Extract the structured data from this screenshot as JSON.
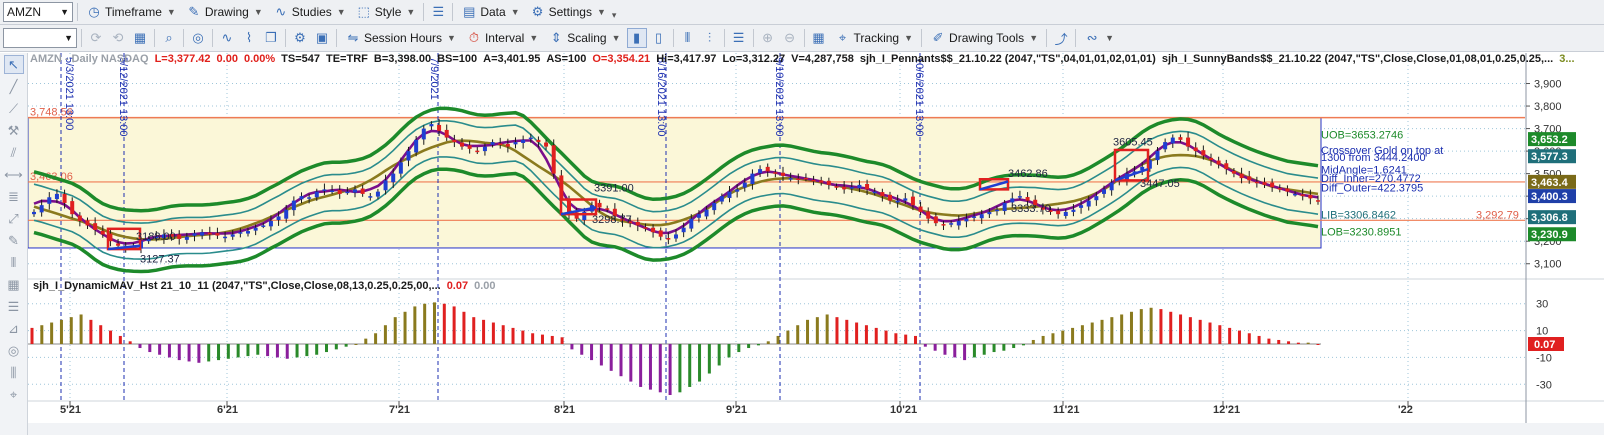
{
  "toolbar1": {
    "symbol": "AMZN",
    "items": [
      {
        "label": "Timeframe",
        "icon": "clock-icon"
      },
      {
        "label": "Drawing",
        "icon": "pencil-icon"
      },
      {
        "label": "Studies",
        "icon": "studies-icon"
      },
      {
        "label": "Style",
        "icon": "style-icon"
      },
      {
        "label": "Data",
        "icon": "data-icon"
      },
      {
        "label": "Settings",
        "icon": "gear-icon"
      }
    ]
  },
  "toolbar2": {
    "items": [
      {
        "label": "Session Hours",
        "icon": "session-hours-icon"
      },
      {
        "label": "Interval",
        "icon": "interval-icon"
      },
      {
        "label": "Scaling",
        "icon": "scaling-icon"
      },
      {
        "label": "Tracking",
        "icon": "tracking-icon"
      },
      {
        "label": "Drawing Tools",
        "icon": "drawing-tools-icon"
      }
    ]
  },
  "header": {
    "symbol_desc": "AMZN - Daily NASDAQ",
    "last": "L=3,377.42",
    "chg": "0.00",
    "pct": "0.00%",
    "ts": "TS=547",
    "te": "TE=TRF",
    "bid": "B=3,398.00",
    "bs": "BS=100",
    "ask": "A=3,401.95",
    "as": "AS=100",
    "open": "O=3,354.21",
    "hi": "Hi=3,417.97",
    "lo": "Lo=3,312.27",
    "vol": "V=4,287,758",
    "study1": "sjh_I_Pennants$$_21.10.22 (2047,\"TS\",04,01,01,02,01,01)",
    "study2": "sjh_I_SunnyBands$$_21.10.22 (2047,\"TS\",Close,Close,01,08,01,0.25,0.25,...",
    "study2_tail": "3..."
  },
  "indicator": {
    "name": "sjh_I_DynamicMAV_Hst 21_10_11 (2047,\"TS\",Close,Close,08,13,0.25,0.25,00,...",
    "value": "0.07",
    "value2": "0.00"
  },
  "chart_data": {
    "type": "candlestick",
    "symbol": "AMZN",
    "interval": "Daily",
    "y_ticks": [
      "3,900",
      "3,800",
      "3,700",
      "3,600",
      "3,500",
      "3,400",
      "3,300",
      "3,200",
      "3,100"
    ],
    "ylim": [
      3050,
      3960
    ],
    "x_ticks": [
      "5'21",
      "6'21",
      "7'21",
      "8'21",
      "9'21",
      "10'21",
      "11'21",
      "12'21",
      "'22"
    ],
    "closes": [
      3330,
      3360,
      3395,
      3410,
      3370,
      3320,
      3290,
      3270,
      3250,
      3230,
      3200,
      3180,
      3170,
      3175,
      3200,
      3210,
      3220,
      3230,
      3220,
      3210,
      3220,
      3235,
      3240,
      3230,
      3225,
      3220,
      3230,
      3240,
      3245,
      3260,
      3270,
      3290,
      3310,
      3340,
      3380,
      3400,
      3395,
      3420,
      3430,
      3425,
      3410,
      3420,
      3430,
      3410,
      3400,
      3420,
      3470,
      3500,
      3550,
      3600,
      3650,
      3700,
      3720,
      3690,
      3660,
      3640,
      3620,
      3610,
      3600,
      3620,
      3640,
      3630,
      3620,
      3640,
      3650,
      3660,
      3640,
      3620,
      3500,
      3380,
      3320,
      3300,
      3330,
      3360,
      3350,
      3340,
      3310,
      3290,
      3280,
      3270,
      3260,
      3240,
      3220,
      3210,
      3230,
      3260,
      3300,
      3320,
      3340,
      3370,
      3400,
      3420,
      3430,
      3460,
      3500,
      3520,
      3510,
      3500,
      3490,
      3480,
      3475,
      3480,
      3470,
      3460,
      3450,
      3440,
      3430,
      3440,
      3450,
      3430,
      3420,
      3400,
      3380,
      3380,
      3390,
      3360,
      3330,
      3300,
      3280,
      3270,
      3280,
      3290,
      3300,
      3310,
      3320,
      3330,
      3340,
      3370,
      3390,
      3400,
      3380,
      3360,
      3340,
      3330,
      3320,
      3330,
      3340,
      3360,
      3380,
      3400,
      3430,
      3460,
      3480,
      3500,
      3510,
      3530,
      3560,
      3600,
      3640,
      3660,
      3650,
      3620,
      3600,
      3580,
      3560,
      3540,
      3520,
      3500,
      3480,
      3470,
      3460,
      3450,
      3440,
      3430,
      3420,
      3410,
      3400,
      3390,
      3380
    ],
    "channel_top_label": "3,748.56",
    "channel_mid_label": "3,463.06",
    "right_line_label": "3,292.79",
    "annotations": [
      "3127.37",
      "3188.00",
      "3391.00",
      "3298.77",
      "3462.86",
      "3333.70",
      "3605.45",
      "3447.05"
    ],
    "vline_labels": [
      "5/3/2021 13:00",
      "5/12/2021 13:00",
      "7/9/2021",
      "8/16/2021 13:00",
      "9/10/2021 13:00",
      "10/6/2021 13:00"
    ],
    "band_labels": [
      "UOB=3653.2746",
      "Crossover Gold on top at",
      "1300 from 3444.2400",
      "MidAngle=1.6241",
      "Diff_Inner=270.4772",
      "Diff_Outer=422.3795",
      "LIB=3306.8462",
      "LOB=3230.8951"
    ],
    "price_badges": [
      {
        "text": "3,653.2",
        "color": "#1d8a2a"
      },
      {
        "text": "3,577.3",
        "color": "#1f6f7a"
      },
      {
        "text": "3,463.4",
        "color": "#7a6a18"
      },
      {
        "text": "3,400.3",
        "color": "#1f3fa8"
      },
      {
        "text": "3,306.8",
        "color": "#1f6f7a"
      },
      {
        "text": "3,230.9",
        "color": "#1d8a2a"
      }
    ],
    "hist_ticks": [
      "30",
      "10",
      "-10",
      "-30"
    ],
    "hist_ylim": [
      -38,
      38
    ],
    "hist_current_badge": "0.07",
    "histogram": [
      12,
      14,
      16,
      18,
      20,
      22,
      18,
      14,
      10,
      6,
      2,
      -3,
      -6,
      -8,
      -10,
      -12,
      -13,
      -14,
      -13,
      -12,
      -11,
      -10,
      -9,
      -8,
      -9,
      -10,
      -11,
      -10,
      -9,
      -8,
      -6,
      -4,
      -2,
      0,
      4,
      8,
      14,
      20,
      24,
      28,
      30,
      31,
      30,
      28,
      24,
      20,
      18,
      16,
      14,
      12,
      10,
      8,
      7,
      6,
      5,
      -4,
      -8,
      -12,
      -16,
      -20,
      -24,
      -28,
      -32,
      -34,
      -36,
      -38,
      -36,
      -32,
      -28,
      -22,
      -16,
      -10,
      -6,
      -3,
      -1,
      2,
      6,
      10,
      14,
      18,
      20,
      22,
      20,
      18,
      16,
      14,
      12,
      10,
      8,
      7,
      6,
      -2,
      -5,
      -8,
      -10,
      -12,
      -10,
      -8,
      -6,
      -5,
      -3,
      -1,
      3,
      6,
      8,
      10,
      12,
      14,
      16,
      18,
      20,
      22,
      24,
      26,
      27,
      26,
      24,
      22,
      20,
      18,
      16,
      14,
      12,
      10,
      8,
      6,
      4,
      3,
      2,
      1,
      1,
      0
    ]
  },
  "colors": {
    "bull": "#1f3fd1",
    "bear": "#e02020",
    "upper_band": "#1d8a2a",
    "inner_band": "#2a8c8c",
    "mid_band": "#8a7a1e",
    "mavg": "#7a0f8c",
    "channel_fill": "#fbf7d8",
    "channel_line": "#ef7b53"
  }
}
